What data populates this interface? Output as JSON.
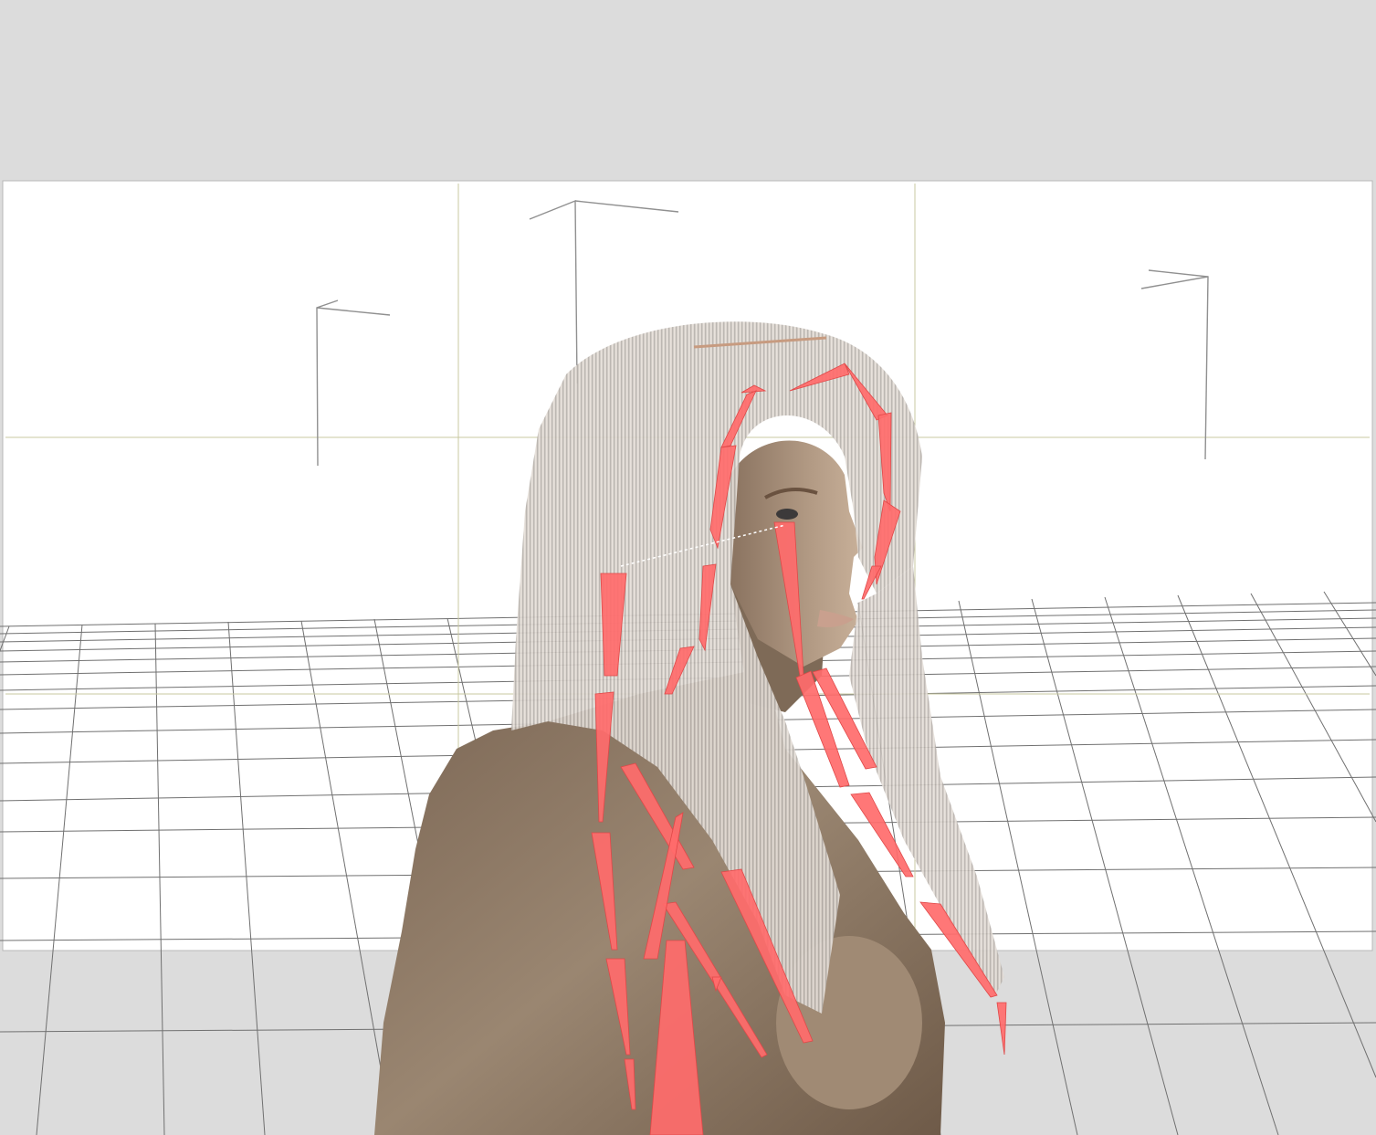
{
  "viewport": {
    "background_color": "#dcdcdc",
    "render_frame_color": "#ffffff",
    "grid_line_color": "#707070",
    "guide_line_color": "#c8c8a0",
    "bone_color": "#ff6b6b",
    "hair_color": "#e8e2dc",
    "skin_color": "#8e7a66",
    "elements": {
      "floor_grid": "floor-grid",
      "render_frame": "render-frame",
      "composition_guides": "composition-guides",
      "scene_lights": [
        "light-gizmo-left",
        "light-gizmo-center",
        "light-gizmo-right"
      ],
      "figure": "figure-model",
      "hair": "hair-mesh",
      "skeleton": "hair-bones"
    }
  }
}
